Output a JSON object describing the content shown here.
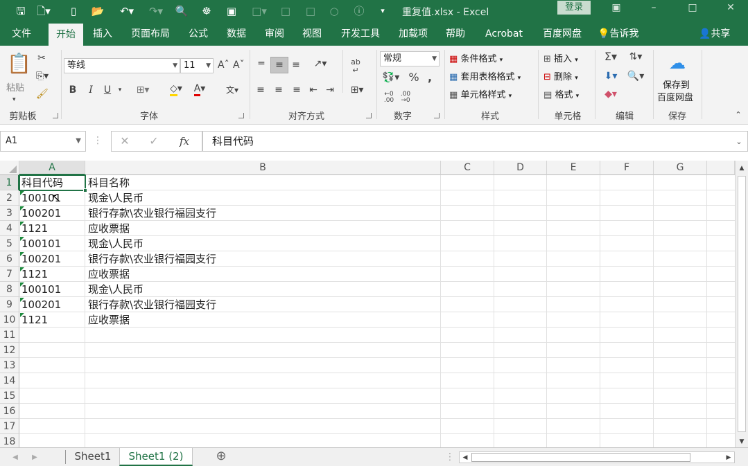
{
  "titlebar": {
    "title": "重复值.xlsx  -  Excel",
    "login": "登录"
  },
  "ribbon_tabs": [
    "文件",
    "开始",
    "插入",
    "页面布局",
    "公式",
    "数据",
    "审阅",
    "视图",
    "开发工具",
    "加载项",
    "帮助",
    "Acrobat",
    "百度网盘"
  ],
  "tell_me": "告诉我",
  "share": "共享",
  "ribbon": {
    "clipboard": {
      "paste": "粘贴",
      "label": "剪贴板"
    },
    "font": {
      "name": "等线",
      "size": "11",
      "label": "字体",
      "bold": "B",
      "italic": "I",
      "underline": "U",
      "grow": "Aˆ",
      "shrink": "Aˇ",
      "color_letter": "A"
    },
    "alignment": {
      "label": "对齐方式"
    },
    "number": {
      "format": "常规",
      "label": "数字",
      "percent": "%",
      "comma": ","
    },
    "styles": {
      "conditional": "条件格式",
      "table": "套用表格格式",
      "cell": "单元格样式",
      "label": "样式"
    },
    "cells": {
      "insert": "插入",
      "delete": "删除",
      "format": "格式",
      "label": "单元格"
    },
    "editing": {
      "label": "编辑",
      "sum": "Σ"
    },
    "save": {
      "btn": "保存到\n百度网盘",
      "line1": "保存到",
      "line2": "百度网盘",
      "label": "保存"
    }
  },
  "formula_bar": {
    "name_box": "A1",
    "fx": "fx",
    "content": "科目代码"
  },
  "columns": [
    "A",
    "B",
    "C",
    "D",
    "E",
    "F",
    "G"
  ],
  "rows": [
    {
      "n": "1",
      "a": "科目代码",
      "b": "科目名称",
      "tri": false
    },
    {
      "n": "2",
      "a": "100101",
      "b": "现金\\人民币",
      "tri": true
    },
    {
      "n": "3",
      "a": "100201",
      "b": "银行存款\\农业银行福园支行",
      "tri": true
    },
    {
      "n": "4",
      "a": "1121",
      "b": "应收票据",
      "tri": true
    },
    {
      "n": "5",
      "a": "100101",
      "b": "现金\\人民币",
      "tri": true
    },
    {
      "n": "6",
      "a": "100201",
      "b": "银行存款\\农业银行福园支行",
      "tri": true
    },
    {
      "n": "7",
      "a": "1121",
      "b": "应收票据",
      "tri": true
    },
    {
      "n": "8",
      "a": "100101",
      "b": "现金\\人民币",
      "tri": true
    },
    {
      "n": "9",
      "a": "100201",
      "b": "银行存款\\农业银行福园支行",
      "tri": true
    },
    {
      "n": "10",
      "a": "1121",
      "b": "应收票据",
      "tri": true
    },
    {
      "n": "11",
      "a": "",
      "b": "",
      "tri": false
    },
    {
      "n": "12",
      "a": "",
      "b": "",
      "tri": false
    },
    {
      "n": "13",
      "a": "",
      "b": "",
      "tri": false
    },
    {
      "n": "14",
      "a": "",
      "b": "",
      "tri": false
    },
    {
      "n": "15",
      "a": "",
      "b": "",
      "tri": false
    },
    {
      "n": "16",
      "a": "",
      "b": "",
      "tri": false
    },
    {
      "n": "17",
      "a": "",
      "b": "",
      "tri": false
    },
    {
      "n": "18",
      "a": "",
      "b": "",
      "tri": false
    }
  ],
  "sheets": [
    "Sheet1",
    "Sheet1 (2)"
  ],
  "active_sheet": "Sheet1 (2)",
  "new_sheet": "⊕",
  "colors": {
    "brand": "#217346",
    "error_triangle": "#1e8a3e"
  }
}
